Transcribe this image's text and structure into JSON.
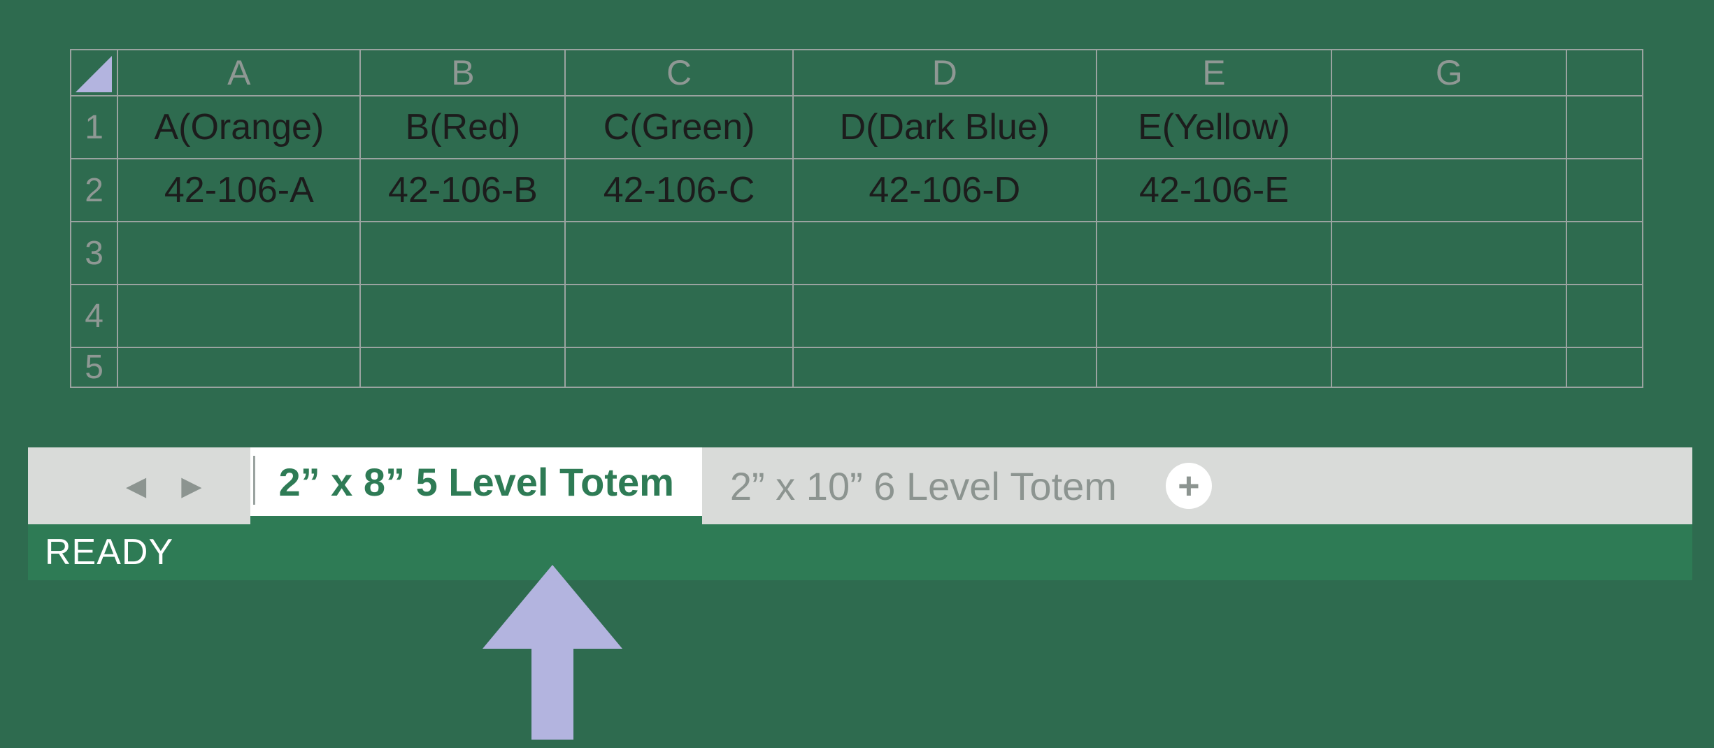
{
  "columns": [
    "A",
    "B",
    "C",
    "D",
    "E",
    "G",
    ""
  ],
  "rows": [
    {
      "num": "1",
      "cells": [
        "A(Orange)",
        "B(Red)",
        "C(Green)",
        "D(Dark Blue)",
        "E(Yellow)",
        "",
        ""
      ]
    },
    {
      "num": "2",
      "cells": [
        "42-106-A",
        "42-106-B",
        "42-106-C",
        "42-106-D",
        "42-106-E",
        "",
        ""
      ]
    },
    {
      "num": "3",
      "cells": [
        "",
        "",
        "",
        "",
        "",
        "",
        ""
      ]
    },
    {
      "num": "4",
      "cells": [
        "",
        "",
        "",
        "",
        "",
        "",
        ""
      ]
    },
    {
      "num": "5",
      "cells": [
        "",
        "",
        "",
        "",
        "",
        "",
        ""
      ]
    }
  ],
  "tabs": {
    "active": "2” x 8” 5 Level Totem",
    "inactive": "2” x 10” 6 Level Totem"
  },
  "status": "READY",
  "colors": {
    "pageBg": "#2e6b4f",
    "accent": "#2e7b55",
    "arrow": "#b3b4df"
  }
}
